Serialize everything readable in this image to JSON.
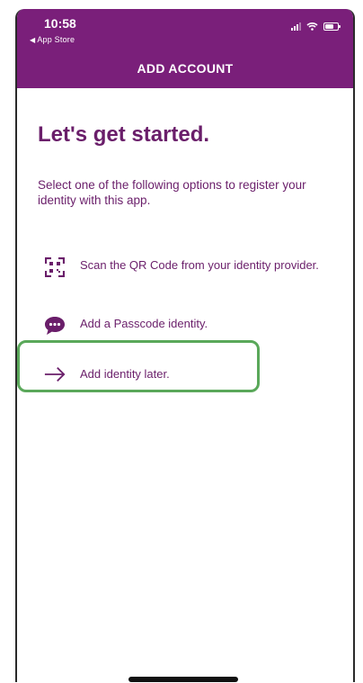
{
  "status_bar": {
    "time": "10:58",
    "back_label": "App Store"
  },
  "nav": {
    "title": "ADD ACCOUNT"
  },
  "main": {
    "heading": "Let's get started.",
    "intro": "Select one of the following options to register your identity with this app.",
    "options": [
      {
        "icon": "qr-code-icon",
        "label": "Scan the QR Code from your identity provider."
      },
      {
        "icon": "chat-bubble-icon",
        "label": "Add a Passcode identity."
      },
      {
        "icon": "arrow-right-icon",
        "label": "Add identity later."
      }
    ]
  },
  "colors": {
    "header_bg": "#7a1f7a",
    "text_purple": "#6a1e6a",
    "highlight_green": "#5aa85a"
  }
}
